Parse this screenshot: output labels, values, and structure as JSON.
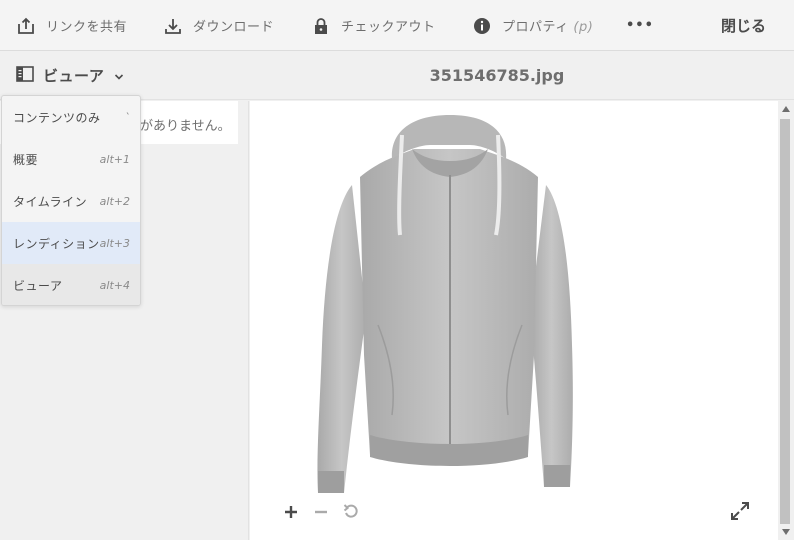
{
  "toolbar": {
    "share_label": "リンクを共有",
    "download_label": "ダウンロード",
    "checkout_label": "チェックアウト",
    "properties_label": "プロパティ",
    "properties_hint": "(p)",
    "more_label": "•••",
    "close_label": "閉じる"
  },
  "header": {
    "rail_label": "ビューア",
    "file_title": "351546785.jpg"
  },
  "rail": {
    "message": "がありません。"
  },
  "menu": {
    "items": [
      {
        "label": "コンテンツのみ",
        "shortcut": "`"
      },
      {
        "label": "概要",
        "shortcut": "alt+1"
      },
      {
        "label": "タイムライン",
        "shortcut": "alt+2"
      },
      {
        "label": "レンディション",
        "shortcut": "alt+3"
      },
      {
        "label": "ビューア",
        "shortcut": "alt+4"
      }
    ]
  },
  "colors": {
    "accent_selected": "#e1eaf8",
    "current_item": "#e8e8e8",
    "hoodie": "#bdbdbd"
  }
}
